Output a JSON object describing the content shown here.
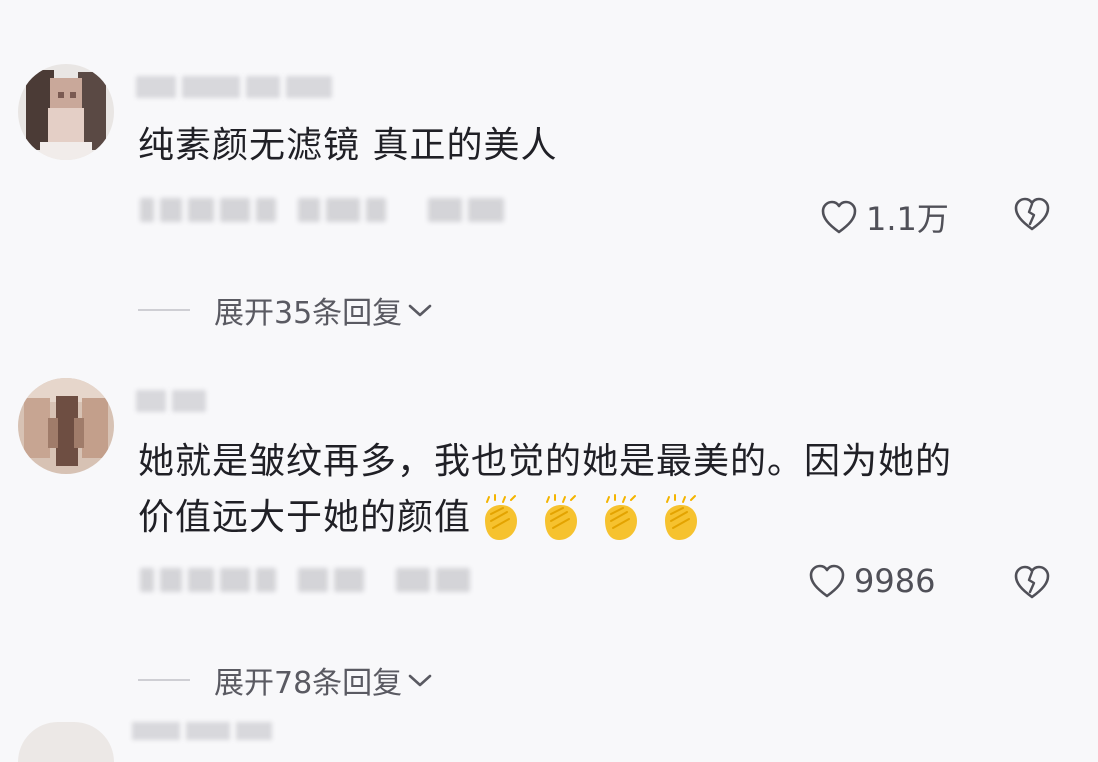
{
  "comments": [
    {
      "text_lines": [
        "纯素颜无滤镜 真正的美人"
      ],
      "likes": "1.1万",
      "expand_label": "展开35条回复",
      "avatar_color": "#6b5a55"
    },
    {
      "text_lines": [
        "她就是皱纹再多，我也觉的她是最美的。因为她的",
        "价值远大于她的颜值"
      ],
      "likes": "9986",
      "expand_label": "展开78条回复",
      "avatar_color": "#8a6f60",
      "emoji_count": 4,
      "emoji_name": "clapping-hands"
    }
  ],
  "colors": {
    "background": "#f8f8fa",
    "text": "#202026",
    "muted": "#5a5a62",
    "emoji": "#f4b400"
  }
}
